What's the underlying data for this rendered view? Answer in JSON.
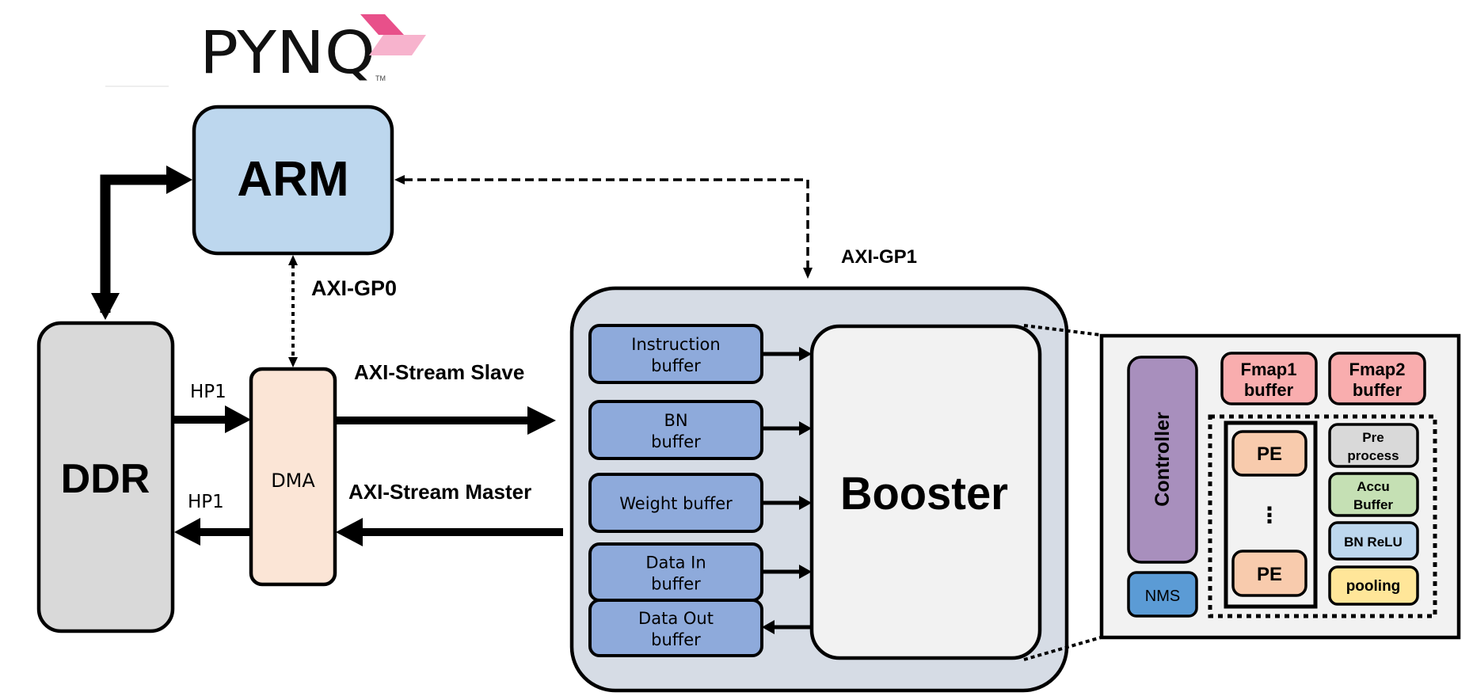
{
  "logo": {
    "text": "PYNQ",
    "trademark": "TM",
    "accent_dark": "#e8508a",
    "accent_light": "#f7b3cd"
  },
  "blocks": {
    "arm": {
      "label": "ARM",
      "color": "#bdd7ee"
    },
    "ddr": {
      "label": "DDR",
      "color": "#d9d9d9"
    },
    "dma": {
      "label": "DMA",
      "color": "#fbe5d6"
    },
    "accelerator": {
      "color": "#d6dce5"
    },
    "booster": {
      "label": "Booster",
      "color": "#f2f2f2"
    }
  },
  "links": {
    "axi_gp0": "AXI-GP0",
    "axi_gp1": "AXI-GP1",
    "hp1_in": "HP1",
    "hp1_out": "HP1",
    "stream_slave": "AXI-Stream Slave",
    "stream_master": "AXI-Stream Master"
  },
  "buffers": {
    "color": "#8eaadb",
    "items": [
      {
        "line1": "Instruction",
        "line2": "buffer",
        "direction": "to-booster"
      },
      {
        "line1": "BN",
        "line2": "buffer",
        "direction": "to-booster"
      },
      {
        "line1": "Weight buffer",
        "line2": "",
        "direction": "to-booster"
      },
      {
        "line1": "Data In",
        "line2": "buffer",
        "direction": "to-booster"
      },
      {
        "line1": "Data Out",
        "line2": "buffer",
        "direction": "from-booster"
      }
    ]
  },
  "detail": {
    "panel_color": "#f2f2f2",
    "controller": {
      "label": "Controller",
      "color": "#a88fbd"
    },
    "nms": {
      "label": "NMS",
      "color": "#5b9bd5"
    },
    "fmap1": {
      "line1": "Fmap1",
      "line2": "buffer",
      "color": "#f9adae"
    },
    "fmap2": {
      "line1": "Fmap2",
      "line2": "buffer",
      "color": "#f9adae"
    },
    "pe_top": {
      "label": "PE",
      "color": "#f8cbad"
    },
    "pe_ellipsis": "⋮",
    "pe_bottom": {
      "label": "PE",
      "color": "#f8cbad"
    },
    "preprocess": {
      "line1": "Pre",
      "line2": "process",
      "color": "#d9d9d9"
    },
    "accu": {
      "line1": "Accu",
      "line2": "Buffer",
      "color": "#c5e0b4"
    },
    "bnrelu": {
      "label": "BN ReLU",
      "color": "#bdd7ee"
    },
    "pooling": {
      "label": "pooling",
      "color": "#ffe699"
    }
  }
}
